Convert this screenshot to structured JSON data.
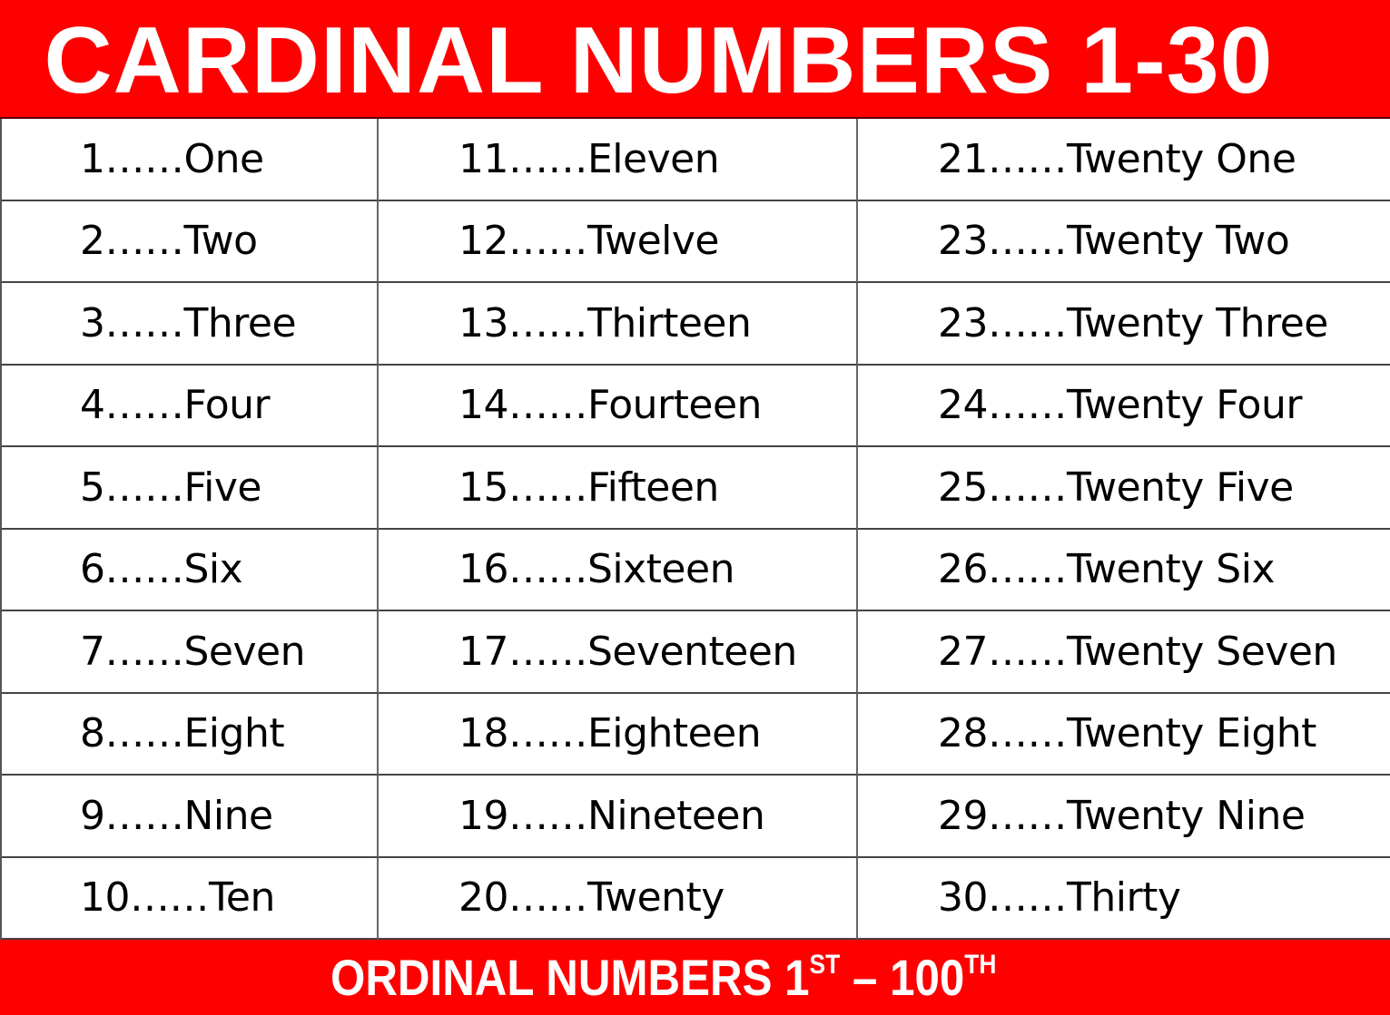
{
  "header": {
    "title": "CARDINAL NUMBERS 1-30",
    "background": "#ff0000",
    "text_color": "#ffffff"
  },
  "columns": [
    {
      "items": [
        "1……One",
        "2……Two",
        "3……Three",
        "4……Four",
        "5……Five",
        "6……Six",
        "7……Seven",
        "8……Eight",
        "9……Nine",
        "10……Ten"
      ]
    },
    {
      "items": [
        "11……Eleven",
        "12……Twelve",
        "13……Thirteen",
        "14……Fourteen",
        "15……Fifteen",
        "16……Sixteen",
        "17……Seventeen",
        "18……Eighteen",
        "19……Nineteen",
        "20……Twenty"
      ]
    },
    {
      "items": [
        "21……Twenty One",
        "23……Twenty Two",
        "23……Twenty Three",
        "24……Twenty Four",
        "25……Twenty Five",
        "26……Twenty Six",
        "27……Twenty Seven",
        "28……Twenty Eight",
        "29……Twenty Nine",
        "30……Thirty"
      ]
    }
  ],
  "footer": {
    "prefix": "ORDINAL NUMBERS 1",
    "sup1": "ST",
    "middle": " – 100",
    "sup2": "TH",
    "background": "#ff0000"
  }
}
